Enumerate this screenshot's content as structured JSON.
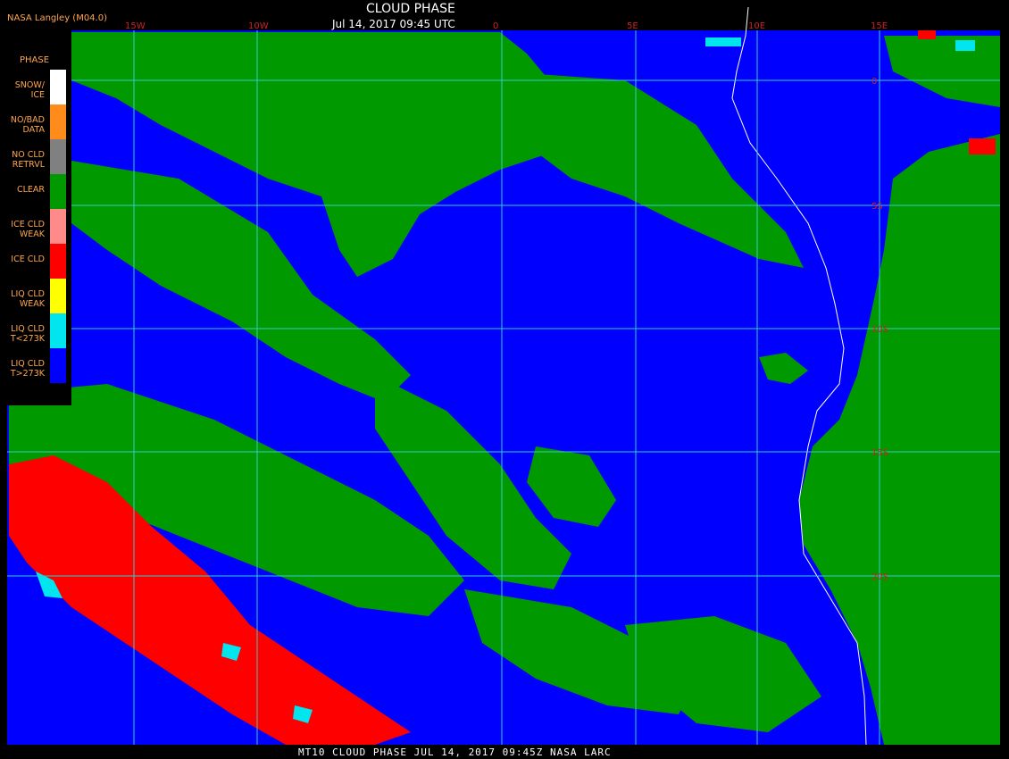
{
  "header": {
    "source": "NASA Langley (M04.0)",
    "title": "CLOUD PHASE",
    "datetime": "Jul 14, 2017 09:45 UTC"
  },
  "footer": "MT10  CLOUD PHASE   JUL 14, 2017 09:45Z   NASA LARC",
  "legend": {
    "title": "PHASE",
    "items": [
      {
        "label": "SNOW/ ICE",
        "color": "#ffffff"
      },
      {
        "label": "NO/BAD DATA",
        "color": "#ff8c1a"
      },
      {
        "label": "NO CLD RETRVL",
        "color": "#808080"
      },
      {
        "label": "CLEAR",
        "color": "#009900"
      },
      {
        "label": "ICE CLD WEAK",
        "color": "#ff8a8a"
      },
      {
        "label": "ICE CLD",
        "color": "#ff0000"
      },
      {
        "label": "LIQ CLD WEAK",
        "color": "#ffff00"
      },
      {
        "label": "LIQ CLD T<273K",
        "color": "#00e5ee"
      },
      {
        "label": "LIQ CLD T>273K",
        "color": "#0000ff"
      }
    ]
  },
  "grid": {
    "lon_labels": [
      "15W",
      "10W",
      "0",
      "5E",
      "10E",
      "15E"
    ],
    "lat_labels": [
      "0",
      "5S",
      "10S",
      "15S",
      "20S"
    ],
    "line_color": "#33cccc"
  },
  "colors": {
    "ocean_liquid": "#0000ff",
    "clear": "#009900",
    "ice": "#ff0000",
    "land": "#009900"
  }
}
